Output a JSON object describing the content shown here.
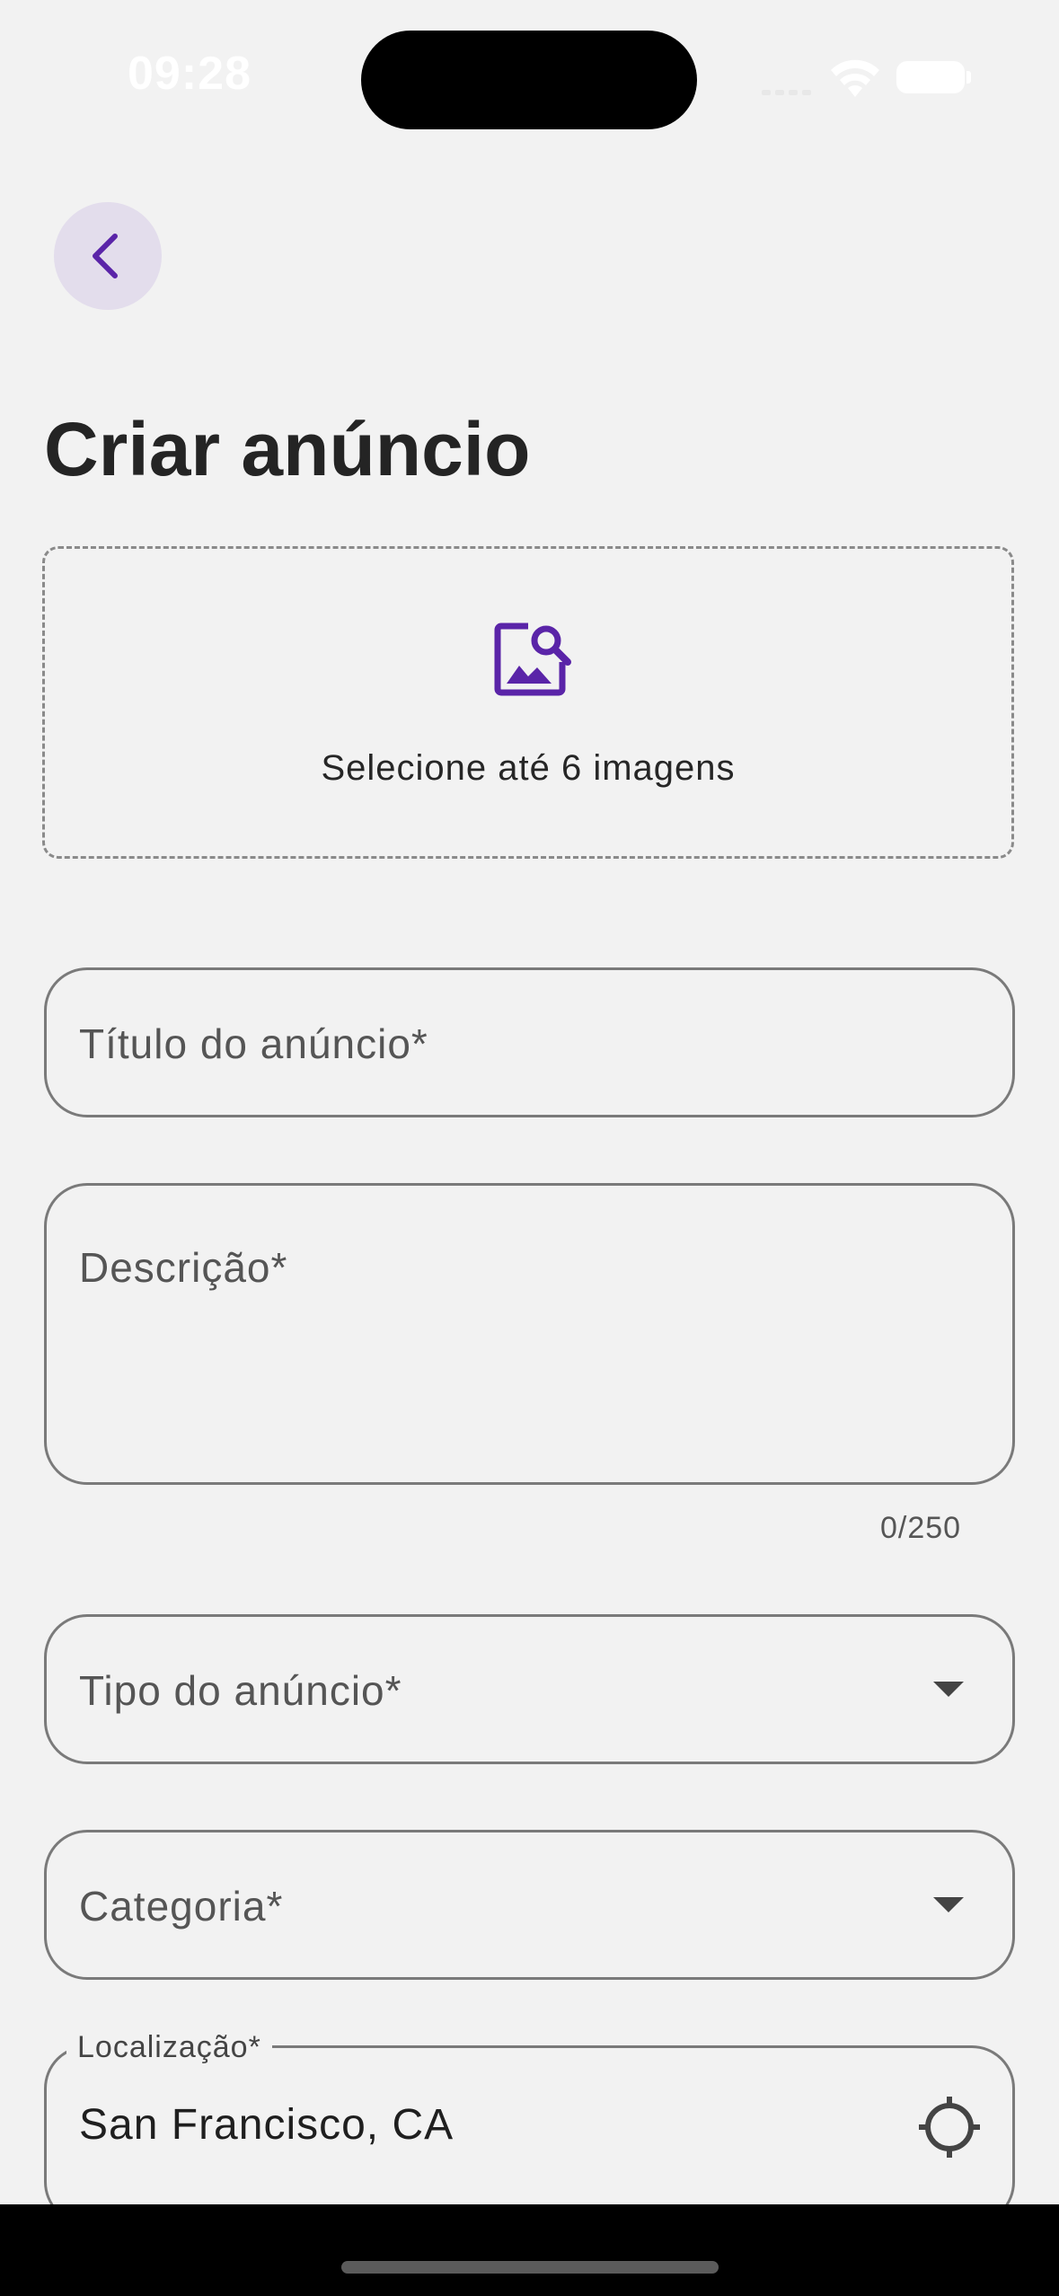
{
  "status_bar": {
    "time": "09:28"
  },
  "header": {
    "back_icon": "chevron-left-icon",
    "title": "Criar anúncio"
  },
  "image_picker": {
    "icon": "image-search-icon",
    "label": "Selecione até 6 imagens"
  },
  "form": {
    "title_field": {
      "placeholder": "Título do anúncio*"
    },
    "description_field": {
      "placeholder": "Descrição*",
      "counter": "0/250"
    },
    "type_field": {
      "placeholder": "Tipo do anúncio*",
      "icon": "dropdown-arrow-icon"
    },
    "category_field": {
      "placeholder": "Categoria*",
      "icon": "dropdown-arrow-icon"
    },
    "location_field": {
      "label": "Localização*",
      "value": "San Francisco, CA",
      "icon": "crosshair-location-icon"
    }
  },
  "colors": {
    "accent": "#5a24a8",
    "back_button_bg": "#e3ddec",
    "background": "#f2f2f2"
  }
}
